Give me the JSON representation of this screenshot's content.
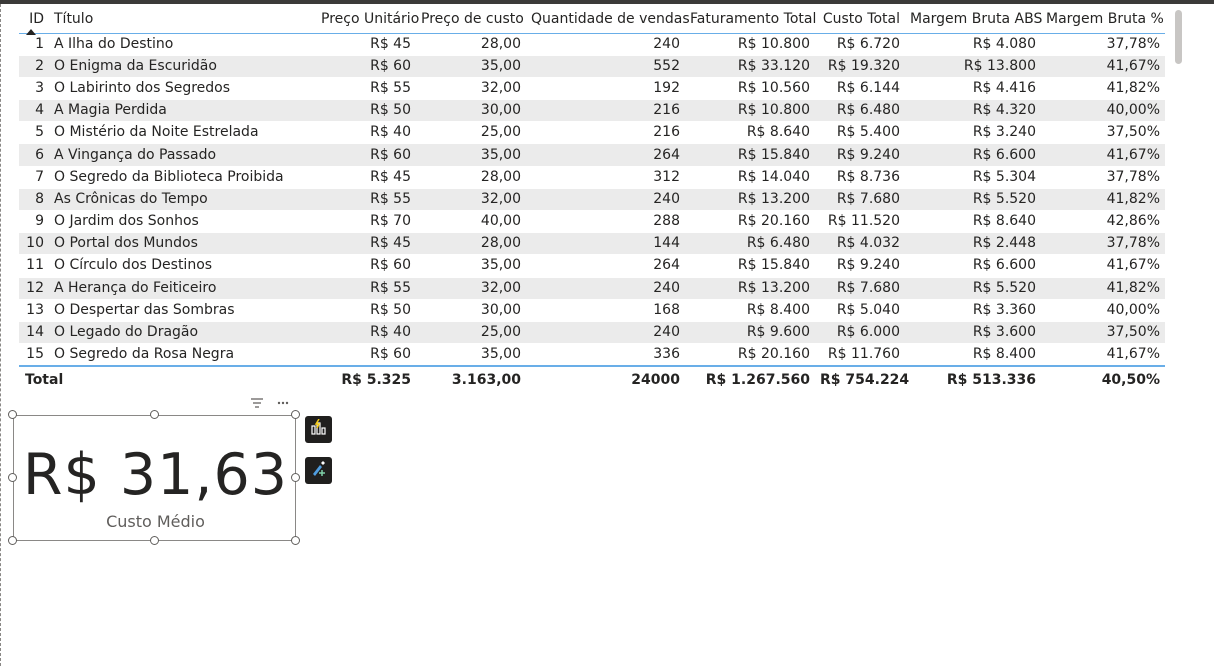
{
  "table": {
    "columns": [
      {
        "label": "ID",
        "align": "r"
      },
      {
        "label": "Título",
        "align": "l"
      },
      {
        "label": "Preço Unitário",
        "align": "r"
      },
      {
        "label": "Preço de custo",
        "align": "r"
      },
      {
        "label": "Quantidade de vendas",
        "align": "r"
      },
      {
        "label": "Faturamento Total",
        "align": "r"
      },
      {
        "label": "Custo Total",
        "align": "r"
      },
      {
        "label": "Margem Bruta ABS",
        "align": "r"
      },
      {
        "label": "Margem Bruta %",
        "align": "r"
      }
    ],
    "rows": [
      [
        "1",
        "A Ilha do Destino",
        "R$ 45",
        "28,00",
        "240",
        "R$ 10.800",
        "R$ 6.720",
        "R$ 4.080",
        "37,78%"
      ],
      [
        "2",
        "O Enigma da Escuridão",
        "R$ 60",
        "35,00",
        "552",
        "R$ 33.120",
        "R$ 19.320",
        "R$ 13.800",
        "41,67%"
      ],
      [
        "3",
        "O Labirinto dos Segredos",
        "R$ 55",
        "32,00",
        "192",
        "R$ 10.560",
        "R$ 6.144",
        "R$ 4.416",
        "41,82%"
      ],
      [
        "4",
        "A Magia Perdida",
        "R$ 50",
        "30,00",
        "216",
        "R$ 10.800",
        "R$ 6.480",
        "R$ 4.320",
        "40,00%"
      ],
      [
        "5",
        "O Mistério da Noite Estrelada",
        "R$ 40",
        "25,00",
        "216",
        "R$ 8.640",
        "R$ 5.400",
        "R$ 3.240",
        "37,50%"
      ],
      [
        "6",
        "A Vingança do Passado",
        "R$ 60",
        "35,00",
        "264",
        "R$ 15.840",
        "R$ 9.240",
        "R$ 6.600",
        "41,67%"
      ],
      [
        "7",
        "O Segredo da Biblioteca Proibida",
        "R$ 45",
        "28,00",
        "312",
        "R$ 14.040",
        "R$ 8.736",
        "R$ 5.304",
        "37,78%"
      ],
      [
        "8",
        "As Crônicas do Tempo",
        "R$ 55",
        "32,00",
        "240",
        "R$ 13.200",
        "R$ 7.680",
        "R$ 5.520",
        "41,82%"
      ],
      [
        "9",
        "O Jardim dos Sonhos",
        "R$ 70",
        "40,00",
        "288",
        "R$ 20.160",
        "R$ 11.520",
        "R$ 8.640",
        "42,86%"
      ],
      [
        "10",
        "O Portal dos Mundos",
        "R$ 45",
        "28,00",
        "144",
        "R$ 6.480",
        "R$ 4.032",
        "R$ 2.448",
        "37,78%"
      ],
      [
        "11",
        "O Círculo dos Destinos",
        "R$ 60",
        "35,00",
        "264",
        "R$ 15.840",
        "R$ 9.240",
        "R$ 6.600",
        "41,67%"
      ],
      [
        "12",
        "A Herança do Feiticeiro",
        "R$ 55",
        "32,00",
        "240",
        "R$ 13.200",
        "R$ 7.680",
        "R$ 5.520",
        "41,82%"
      ],
      [
        "13",
        "O Despertar das Sombras",
        "R$ 50",
        "30,00",
        "168",
        "R$ 8.400",
        "R$ 5.040",
        "R$ 3.360",
        "40,00%"
      ],
      [
        "14",
        "O Legado do Dragão",
        "R$ 40",
        "25,00",
        "240",
        "R$ 9.600",
        "R$ 6.000",
        "R$ 3.600",
        "37,50%"
      ],
      [
        "15",
        "O Segredo da Rosa Negra",
        "R$ 60",
        "35,00",
        "336",
        "R$ 20.160",
        "R$ 11.760",
        "R$ 8.400",
        "41,67%"
      ]
    ],
    "total": [
      "Total",
      "",
      "R$ 5.325",
      "3.163,00",
      "24000",
      "R$ 1.267.560",
      "R$ 754.224",
      "R$ 513.336",
      "40,50%"
    ],
    "sort_column": "ID",
    "sort_direction": "ascending"
  },
  "card": {
    "value": "R$ 31,63",
    "label": "Custo Médio"
  },
  "icons": {
    "filter": "filter-icon",
    "more": "more-options-icon",
    "side_buttons": [
      "build-visual-icon",
      "format-visual-icon"
    ]
  },
  "colors": {
    "header_line": "#69aee8",
    "row_stripe": "#ebebeb",
    "side_button_bg": "#201f1e",
    "side_button_accent": "#f2c811"
  }
}
